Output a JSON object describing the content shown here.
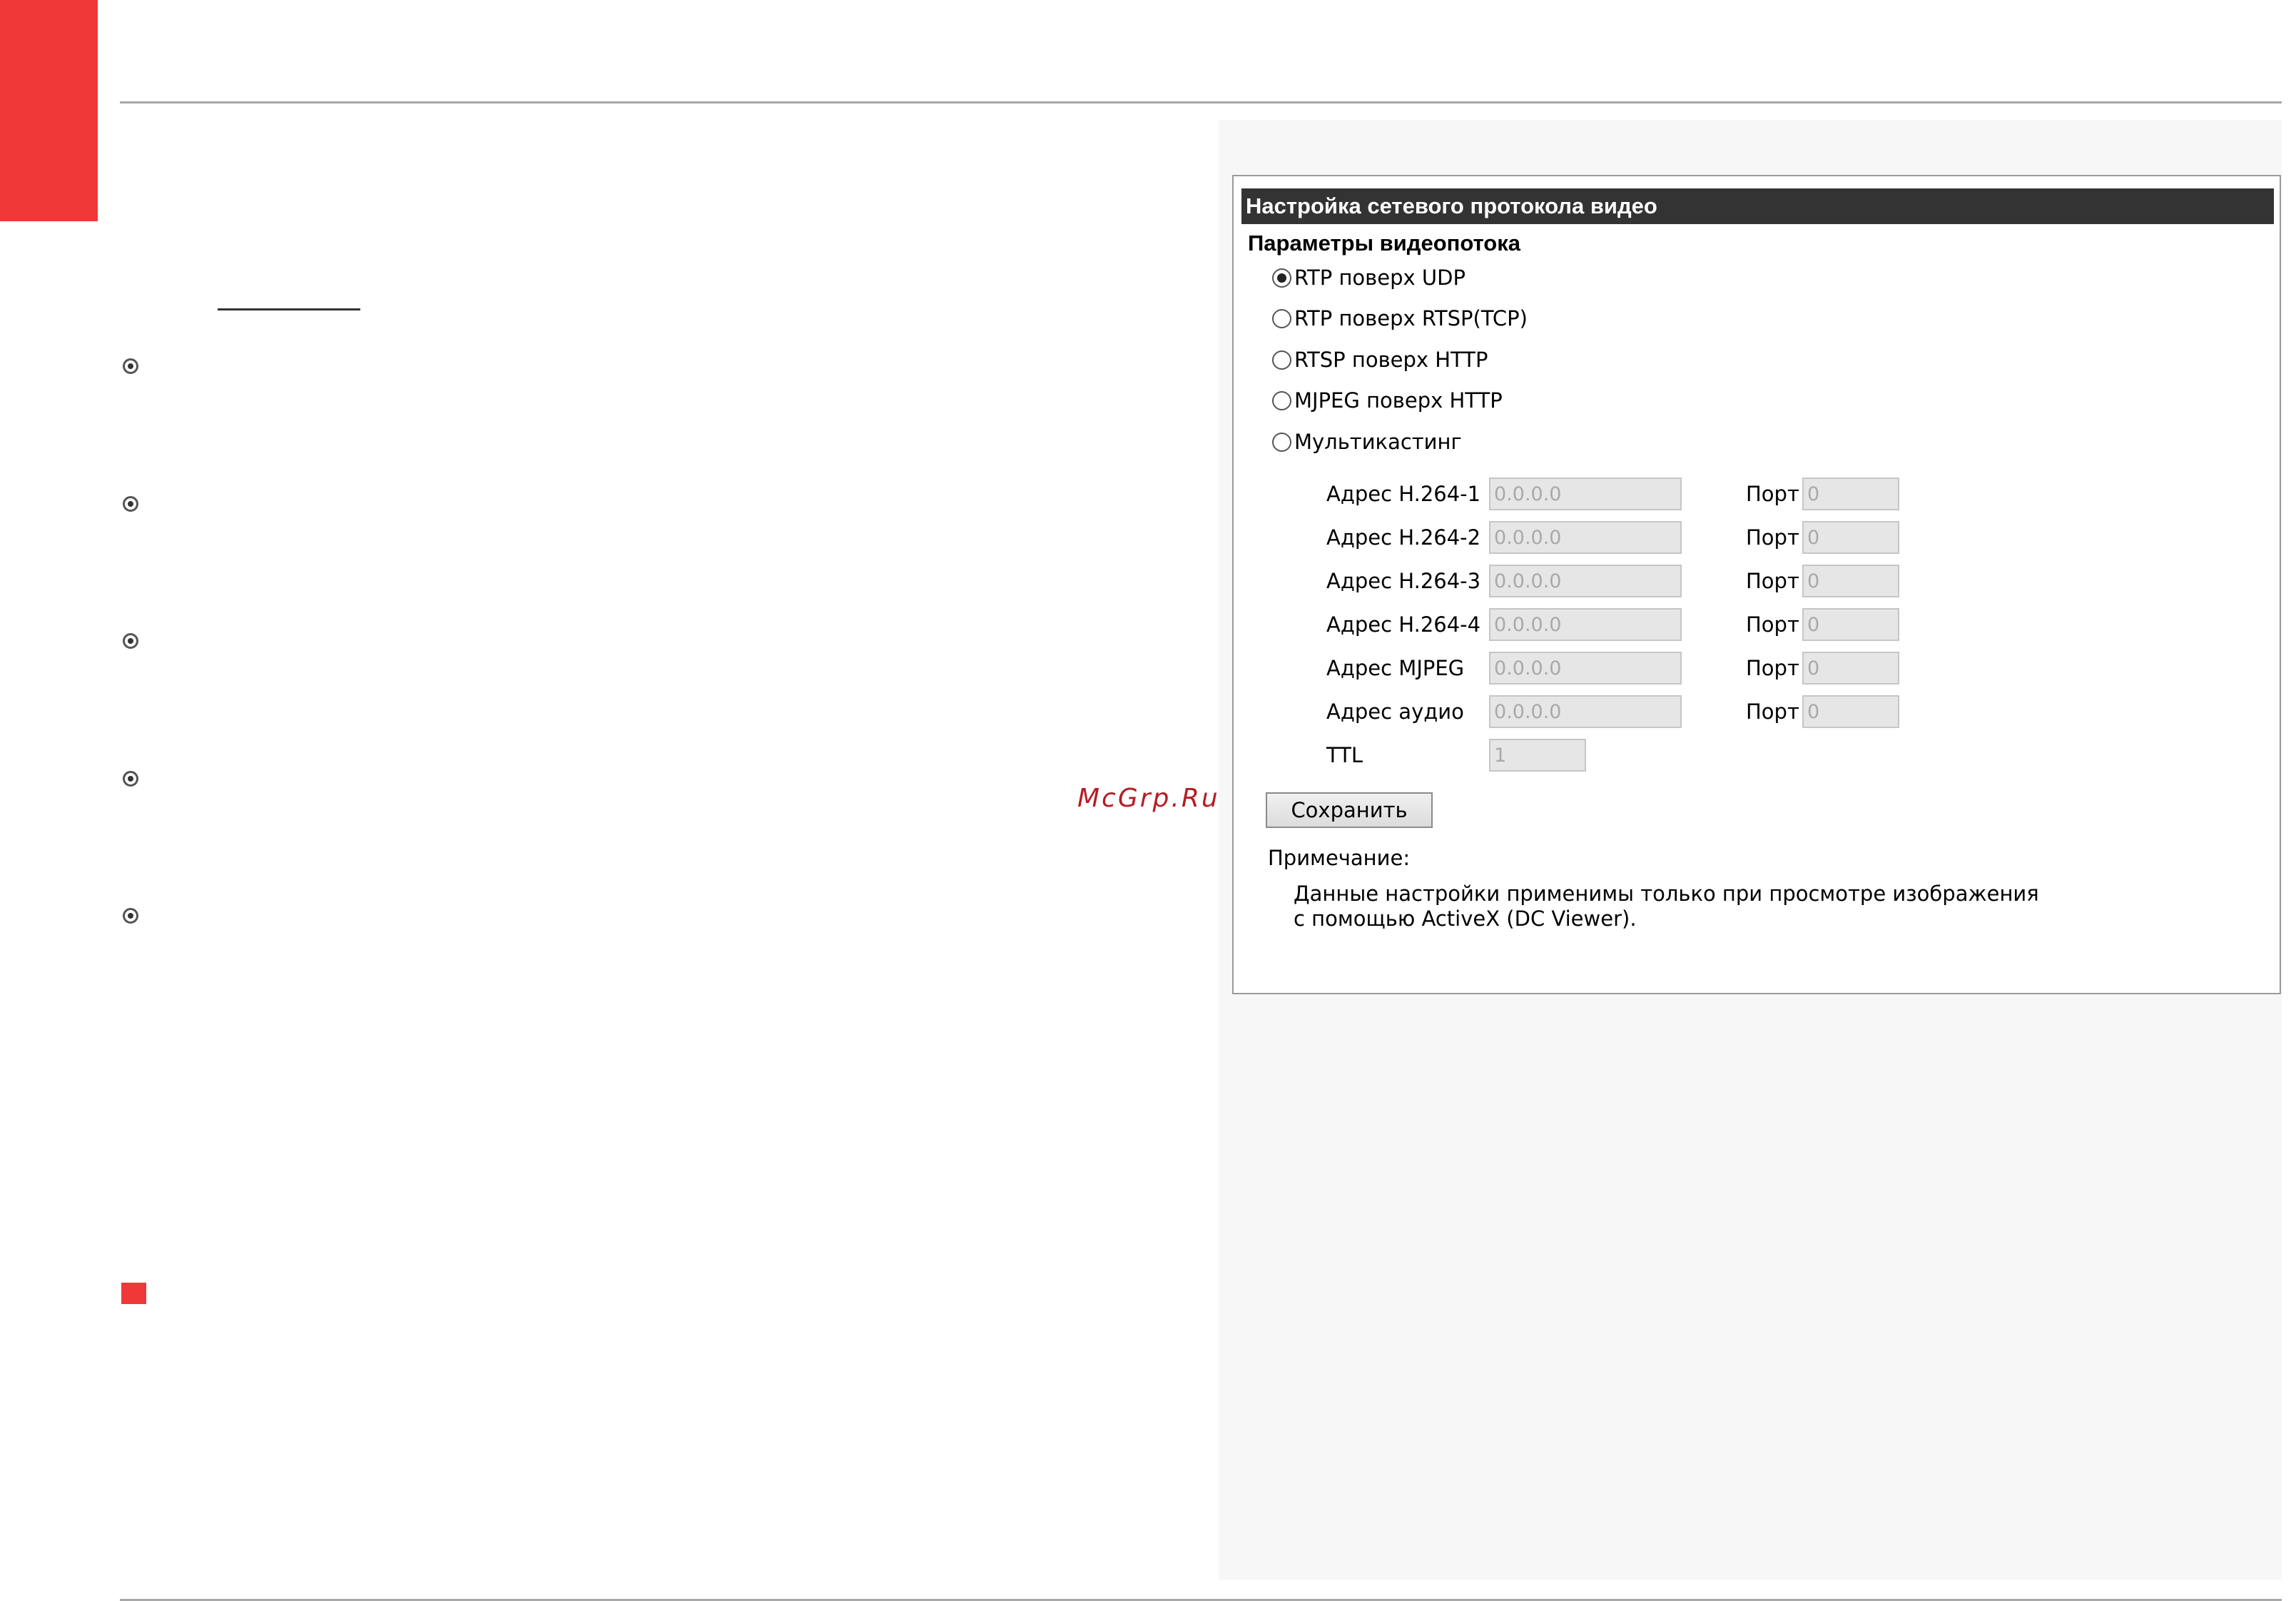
{
  "colors": {
    "accent": "#f13838",
    "panel_title_bg": "#333333",
    "watermark": "#b51d24"
  },
  "watermark": "McGrp.Ru",
  "panel": {
    "title": "Настройка сетевого протокола видео",
    "section_title": "Параметры видеопотока",
    "stream_options": [
      {
        "label": "RTP поверх UDP",
        "selected": true
      },
      {
        "label": "RTP поверх RTSP(TCP)",
        "selected": false
      },
      {
        "label": "RTSP поверх HTTP",
        "selected": false
      },
      {
        "label": "MJPEG поверх HTTP",
        "selected": false
      },
      {
        "label": "Мультикастинг",
        "selected": false
      }
    ],
    "multicast_fields": [
      {
        "label": "Адрес H.264-1",
        "address": "0.0.0.0",
        "port_label": "Порт",
        "port": "0"
      },
      {
        "label": "Адрес H.264-2",
        "address": "0.0.0.0",
        "port_label": "Порт",
        "port": "0"
      },
      {
        "label": "Адрес H.264-3",
        "address": "0.0.0.0",
        "port_label": "Порт",
        "port": "0"
      },
      {
        "label": "Адрес H.264-4",
        "address": "0.0.0.0",
        "port_label": "Порт",
        "port": "0"
      },
      {
        "label": "Адрес MJPEG",
        "address": "0.0.0.0",
        "port_label": "Порт",
        "port": "0"
      },
      {
        "label": "Адрес аудио",
        "address": "0.0.0.0",
        "port_label": "Порт",
        "port": "0"
      }
    ],
    "ttl": {
      "label": "TTL",
      "value": "1"
    },
    "save_label": "Сохранить",
    "note": {
      "title": "Примечание:",
      "lines": [
        "Данные настройки применимы только при просмотре изображения",
        "с помощью ActiveX (DC Viewer)."
      ]
    }
  }
}
